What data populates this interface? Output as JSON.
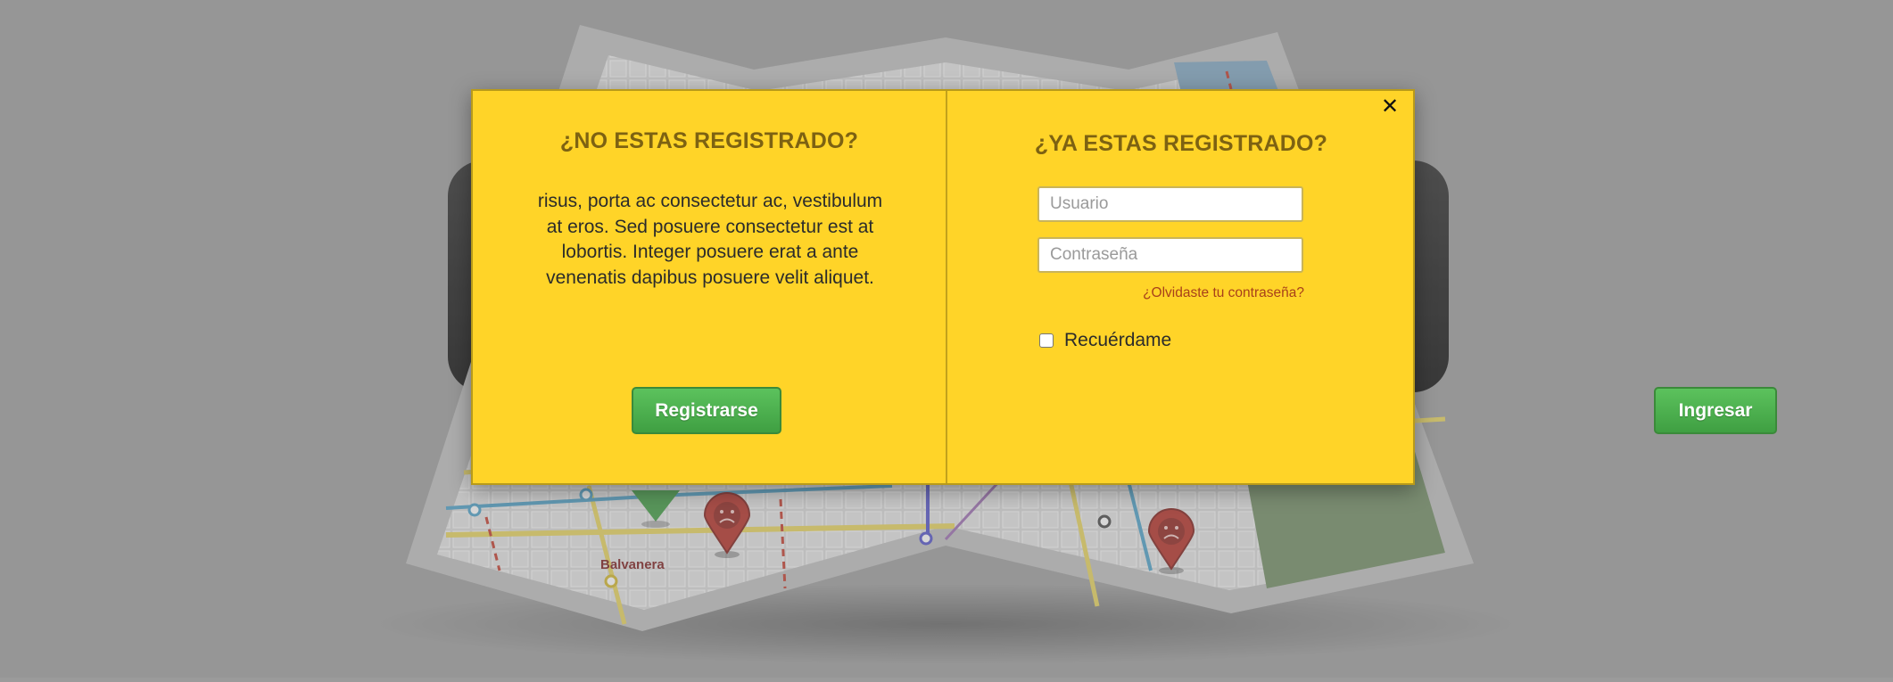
{
  "modal": {
    "close_icon": "close-icon",
    "register": {
      "title": "¿NO ESTAS REGISTRADO?",
      "body": "risus, porta ac consectetur ac, vestibulum at eros. Sed posuere consectetur est at lobortis. Integer posuere erat a ante venenatis dapibus posuere velit aliquet.",
      "button_label": "Registrarse"
    },
    "login": {
      "title": "¿YA ESTAS REGISTRADO?",
      "username_placeholder": "Usuario",
      "password_placeholder": "Contraseña",
      "forgot_link": "¿Olvidaste tu contraseña?",
      "remember_label": "Recuérdame",
      "remember_checked": false,
      "button_label": "Ingresar"
    }
  },
  "background": {
    "map_label": "Balvanera",
    "pins": [
      "green-map-pin",
      "sad-face-pin",
      "sad-face-pin"
    ]
  },
  "colors": {
    "modal_bg": "#ffd428",
    "title": "#7d6212",
    "button_green": "#4caf50",
    "link": "#a8401a"
  }
}
